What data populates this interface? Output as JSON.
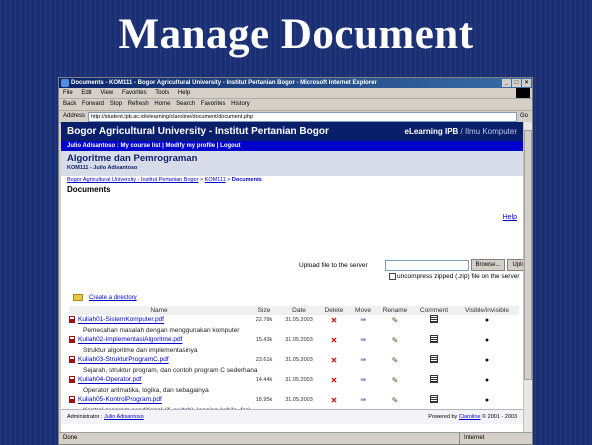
{
  "slide": {
    "title": "Manage Document"
  },
  "browser": {
    "window_title": "Documents - KOM111 - Bogor Agricultural University - Institut Pertanian Bogor - Microsoft Internet Explorer",
    "menu": [
      "File",
      "Edit",
      "View",
      "Favorites",
      "Tools",
      "Help"
    ],
    "toolbar": [
      "Back",
      "Forward",
      "Stop",
      "Refresh",
      "Home",
      "Search",
      "Favorites",
      "History"
    ],
    "address_label": "Address",
    "address_value": "http://student.ipb.ac.id/elearning/claroline/document/document.php",
    "go_label": "Go",
    "status_text": "Done",
    "status_zone": "Internet"
  },
  "page": {
    "banner_left": "Bogor Agricultural University - Institut Pertanian Bogor",
    "banner_right_bold": "eLearning IPB",
    "banner_right_light": " / Ilmu Komputer",
    "user_bar": "Julio Adisantoso : My course list | Modify my profile | Logout",
    "course_title": "Algoritme dan Pemrograman",
    "course_sub": "KOM111 - Julio Adisantoso",
    "breadcrumb_1": "Bogor Agricultural University - Institut Pertanian Bogor",
    "breadcrumb_2": "KOM111",
    "breadcrumb_3": "Documents",
    "breadcrumb_sep": " > ",
    "heading": "Documents",
    "help": "Help",
    "upload_label": "Upload file to the server",
    "browse_label": "Browse...",
    "upload_button": "Upload",
    "unzip_label": "uncompress zipped (.zip) file on the server",
    "create_dir": "Create a directory",
    "columns": [
      "Name",
      "Size",
      "Date",
      "Delete",
      "Move",
      "Rename",
      "Comment",
      "Visible/invisible"
    ],
    "files": [
      {
        "name": "Kuliah01-SistemKomputer.pdf",
        "size": "22.78k",
        "date": "31.05.2003",
        "desc": "Pemecahan masalah dengan menggunakan komputer"
      },
      {
        "name": "Kuliah02-ImplementasiAlgoritme.pdf",
        "size": "15.43k",
        "date": "31.05.2003",
        "desc": "Struktur algoritme dan implementasinya"
      },
      {
        "name": "Kuliah03-StrukturProgramC.pdf",
        "size": "23.61k",
        "date": "31.05.2003",
        "desc": "Sejarah, struktur program, dan contoh program C sederhana"
      },
      {
        "name": "Kuliah04-Operator.pdf",
        "size": "14.44k",
        "date": "31.05.2003",
        "desc": "Operator aritmatika, logika, dan sebagainya"
      },
      {
        "name": "Kuliah05-KontrolProgram.pdf",
        "size": "18.95k",
        "date": "31.05.2003",
        "desc": "Kontrol program conditional (if, switch), looping (while, for)"
      }
    ],
    "footer_admin_label": "Administrator : ",
    "footer_admin_name": "Julio Adisantoso",
    "footer_powered_label": "Powered by ",
    "footer_powered_name": "Claroline",
    "footer_copyright": " © 2001 - 2003"
  },
  "icons": {
    "delete": "cross-icon",
    "move": "move-icon",
    "rename": "rename-icon",
    "comment": "comment-icon",
    "visible": "eye-icon"
  }
}
